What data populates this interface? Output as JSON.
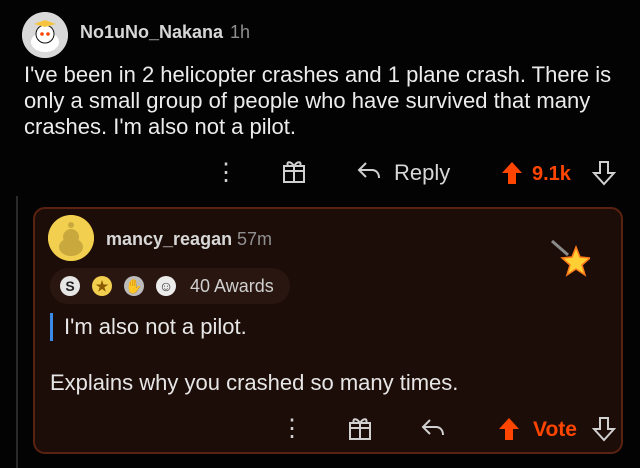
{
  "comment": {
    "username": "No1uNo_Nakana",
    "time": "1h",
    "body": "I've been in 2 helicopter crashes and 1 plane crash. There is only a small group of people who have survived that many crashes. I'm also not a pilot.",
    "actions": {
      "more": "⋮",
      "reply": "Reply",
      "score": "9.1k"
    }
  },
  "reply": {
    "username": "mancy_reagan",
    "time": "57m",
    "awards_label": "40 Awards",
    "quote": "I'm also not a pilot.",
    "body": "Explains why you crashed so many times.",
    "actions": {
      "more": "⋮",
      "vote": "Vote"
    }
  },
  "icons": {
    "more": "more-options-icon",
    "award": "gift-award-icon",
    "reply": "reply-arrow-icon",
    "upvote": "upvote-icon",
    "downvote": "downvote-icon",
    "star": "star-award-icon"
  },
  "colors": {
    "background": "#030303",
    "accent": "#ff4500",
    "card_background": "#1d0d08",
    "card_border": "#5a2210",
    "quote_bar": "#3a8be8"
  }
}
